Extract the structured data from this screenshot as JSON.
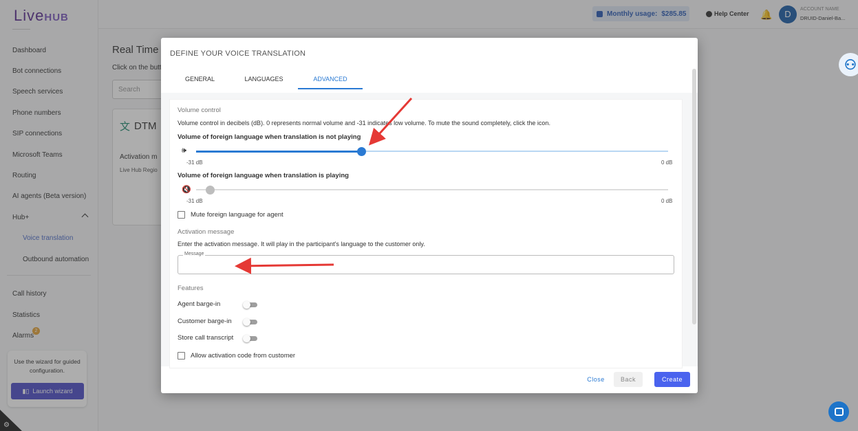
{
  "app": {
    "logo_main": "Live",
    "logo_hub": "HUB",
    "nav": [
      {
        "label": "Dashboard"
      },
      {
        "label": "Bot connections"
      },
      {
        "label": "Speech services"
      },
      {
        "label": "Phone numbers"
      },
      {
        "label": "SIP connections"
      },
      {
        "label": "Microsoft Teams"
      },
      {
        "label": "Routing"
      },
      {
        "label": "AI agents (Beta version)"
      },
      {
        "label": "Hub+"
      },
      {
        "label": "Voice translation"
      },
      {
        "label": "Outbound automation"
      },
      {
        "label": "Call history"
      },
      {
        "label": "Statistics"
      },
      {
        "label": "Alarms"
      }
    ],
    "alarm_count": "2",
    "wizard": {
      "text": "Use the wizard for guided configuration.",
      "button": "Launch wizard"
    }
  },
  "topbar": {
    "usage_label": "Monthly usage:",
    "usage_value": "$285.85",
    "help": "Help Center",
    "avatar_initial": "D",
    "account_label": "ACCOUNT NAME",
    "account_name": "DRUID-Daniel-Ba..."
  },
  "page": {
    "title": "Real Time V",
    "subtitle": "Click on the butt",
    "search_placeholder": "Search",
    "card_title": "DTM",
    "card_activation": "Activation m",
    "card_sub": "Live Hub Regio"
  },
  "modal": {
    "title": "DEFINE YOUR VOICE TRANSLATION",
    "tabs": [
      {
        "label": "GENERAL"
      },
      {
        "label": "LANGUAGES"
      },
      {
        "label": "ADVANCED"
      }
    ],
    "volume": {
      "section": "Volume control",
      "desc": "Volume control in decibels (dB). 0 represents normal volume and -31 indicates low volume. To mute the sound completely, click the icon.",
      "slider1_label": "Volume of foreign language when translation is not playing",
      "slider1_value": 0.35,
      "slider2_label": "Volume of foreign language when translation is playing",
      "slider2_value": 0.03,
      "min": "-31 dB",
      "max": "0 dB"
    },
    "mute_agent": "Mute foreign language for agent",
    "activation": {
      "section": "Activation message",
      "desc": "Enter the activation message. It will play in the participant's language to the customer only.",
      "field_label": "Message",
      "field_value": ""
    },
    "features": {
      "section": "Features",
      "items": [
        {
          "label": "Agent barge-in"
        },
        {
          "label": "Customer barge-in"
        },
        {
          "label": "Store call transcript"
        }
      ]
    },
    "allow_activation": "Allow activation code from customer",
    "buttons": {
      "close": "Close",
      "back": "Back",
      "create": "Create"
    }
  },
  "colors": {
    "accent": "#2a7ad3",
    "create_button": "#4a63ee",
    "annotation_arrow": "#e53935"
  }
}
